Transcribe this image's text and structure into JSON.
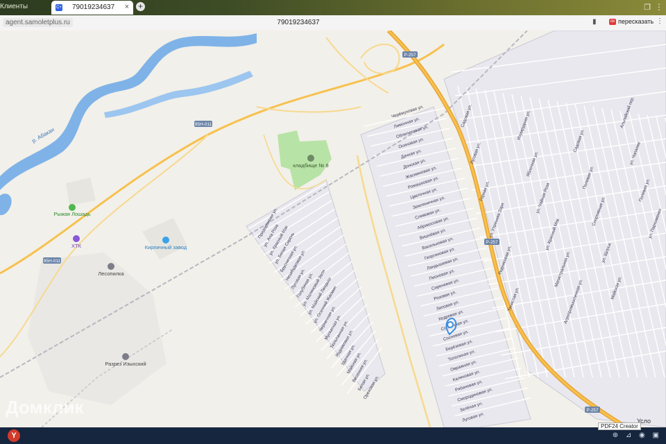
{
  "browser": {
    "left_tab_label": "Клиенты",
    "tab_title": "79019234637",
    "favicon_text": "C+",
    "tab_close": "×",
    "new_tab": "+",
    "url": "agent.samoletplus.ru",
    "page_title": "79019234637",
    "bookmark_icon": "bookmark-icon",
    "translate_label": "пересказать",
    "translate_badge": "ох"
  },
  "map": {
    "river_label": "р. Абакан",
    "roads": [
      "Р-257",
      "Р-257",
      "Р-257",
      "95Н-011",
      "95Н-011"
    ],
    "pois": {
      "cemetery": "кладбище № 8",
      "horse": "Рыжая Лошадь",
      "xtk": "ХТК",
      "brick": "Кирпичный завод",
      "sawmill": "Лесопилка",
      "quarry": "Разрез Изыхский"
    },
    "streets_mid": [
      "Черёмуховая ул.",
      "Лимонная ул.",
      "Облепиховая ул.",
      "Осиновая ул.",
      "Дачная ул.",
      "Донская ул.",
      "Жасминовая ул.",
      "Ромашковая ул.",
      "Цветочная ул.",
      "Земляничная ул.",
      "Сливовая ул.",
      "Абрикосовая ул.",
      "Вишнёвая ул.",
      "Васильковая ул.",
      "Георгиновая ул.",
      "Ландышевая ул.",
      "Пионовая ул.",
      "Сиреневая ул.",
      "Розовая ул.",
      "Липовая ул.",
      "Кедровая ул.",
      "Солнечная ул.",
      "Сосновая ул.",
      "Берёзовая ул.",
      "Тополиная ул.",
      "Овражная ул.",
      "Калиновая ул.",
      "Рябиновая ул.",
      "Смородиновая ул.",
      "Зелёная ул.",
      "Луговая ул."
    ],
    "streets_left": [
      "Придорожная ул.",
      "ул. Ала Роза",
      "ул. Красный Мак",
      "ул. Белая Сирень",
      "Брусничная ул.",
      "Незабудковая ул.",
      "Луговая ул.",
      "Голубиная ул.",
      "ул. Малиновый Звон",
      "ул. Майский Ландыш",
      "ул. Осенний Жасмин",
      "Черничная ул.",
      "Мускатная ул.",
      "Тюльпанная ул.",
      "Родниковая ул.",
      "Удачная ул.",
      "Майская ул.",
      "Весенняя ул.",
      "Белая ул.",
      "Ореховая ул."
    ],
    "streets_right": [
      "Садовая ул.",
      "Луговая ул.",
      "Горная ул.",
      "ул. Утренняя Заря",
      "Родниковая ул.",
      "Тенистая ул.",
      "Изумрудная ул.",
      "Яблочная ул.",
      "ул. Чайная Роза",
      "ул. Красный Мак",
      "Магистральная ул.",
      "Агропромышленная ул.",
      "Садовая ул.",
      "Полевая ул.",
      "Спортивная ул.",
      "ул. Щорса",
      "Майская ул.",
      "Альпийский пер.",
      "ул. Чапаева",
      "Полевая ул.",
      "ул. Пархоменко"
    ],
    "watermark": "Домклик",
    "right_edge_label": "Усло"
  },
  "taskbar": {
    "start_letter": "Y",
    "tray_text": "⊕ ⊿ ◉ ▣",
    "tooltip": "PDF24 Creator"
  },
  "colors": {
    "land": "#f2f0ea",
    "river": "#7fb3e8",
    "highway": "#f7c14e",
    "cemetery": "#b8e3a6",
    "marker": "#3b8fe0"
  }
}
